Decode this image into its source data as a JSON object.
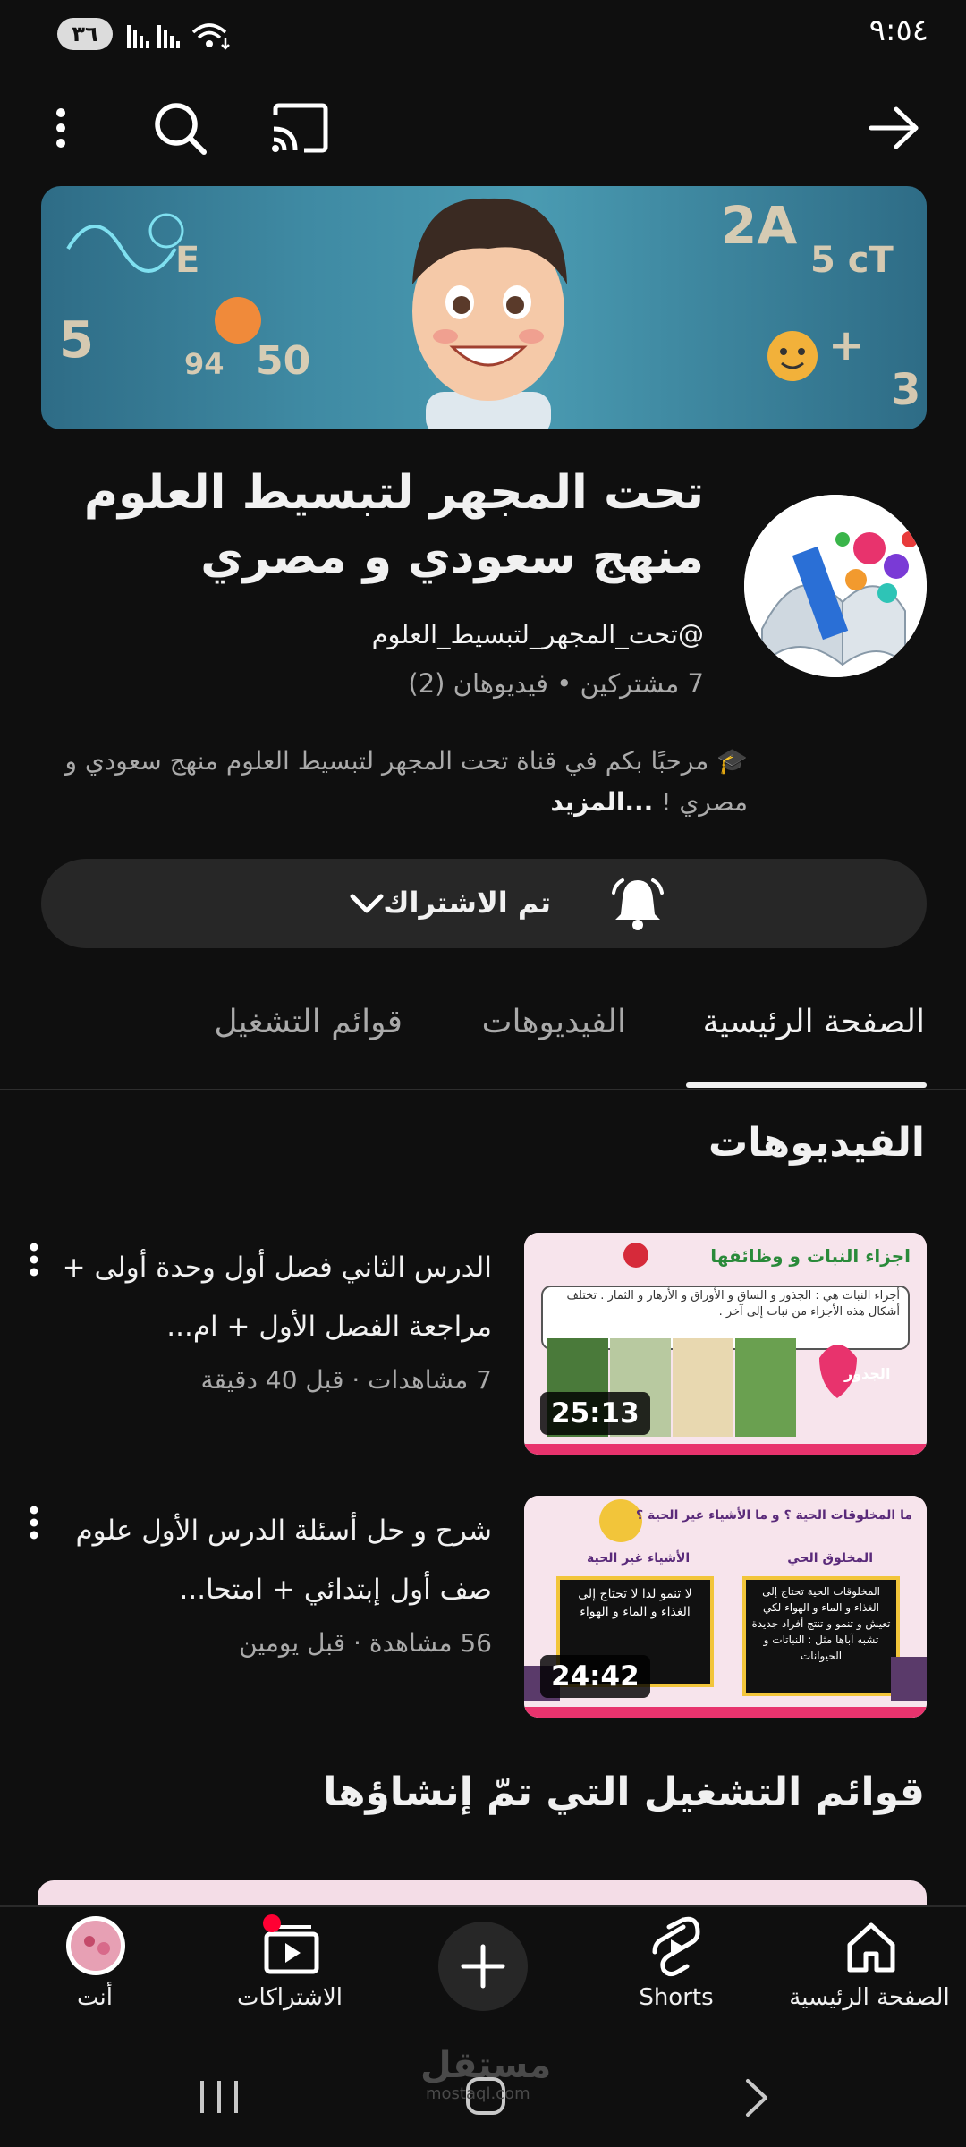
{
  "status_bar": {
    "time": "٩:٥٤",
    "battery": "٣٦"
  },
  "channel": {
    "title_line1": "تحت المجهر لتبسيط العلوم",
    "title_line2": "منهج سعودي و مصري",
    "handle": "@تحت_المجهر_لتبسيط_العلوم",
    "stats": "7 مشتركين • فيديوهان (2)",
    "description": "🎓 مرحبًا بكم في قناة  تحت المجهر لتبسيط العلوم منهج سعودي و مصري  ! ",
    "more_label": "...المزيد"
  },
  "subscribe": {
    "label": "تم الاشتراك"
  },
  "tabs": [
    {
      "label": "الصفحة الرئيسية",
      "active": true
    },
    {
      "label": "الفيديوهات",
      "active": false
    },
    {
      "label": "قوائم التشغيل",
      "active": false
    }
  ],
  "sections": {
    "videos_heading": "الفيديوهات",
    "playlists_heading": "قوائم التشغيل التي تمّ إنشاؤها"
  },
  "videos": [
    {
      "title": "الدرس الثاني فصل أول وحدة أولى + مراجعة الفصل الأول + ام...",
      "meta": "7 مشاهدات · قبل 40 دقيقة",
      "duration": "25:13",
      "thumb_heading": "اجزاء النبات و وظائفها",
      "thumb_text": "أجزاء النبات هي : الجذور و الساق و الأوراق و الأزهار و الثمار . تختلف أشكال هذه الأجزاء من نبات إلى آخر .",
      "thumb_badge": "الجذور"
    },
    {
      "title": "شرح و حل أسئلة الدرس الأول علوم صف أول إبتدائي + امتحا...",
      "meta": "56 مشاهدة · قبل يومين",
      "duration": "24:42",
      "thumb_heading": "ما المخلوقات الحية ؟ و ما الأشياء غير الحية ؟",
      "thumb_left_label": "الأشياء غير الحية",
      "thumb_right_label": "المخلوق الحي",
      "thumb_left_box": "لا تنمو  لذا لا تحتاج إلى الغذاء و الماء و الهواء",
      "thumb_right_box": "المخلوقات الحية تحتاج إلى الغذاء و الماء و الهواء لكي تعيش و تنمو و تنتج أفراد جديدة تشبه آباها مثل : النباتات و الحيوانات"
    }
  ],
  "bottom_nav": [
    {
      "label": "الصفحة الرئيسية",
      "icon": "home-icon"
    },
    {
      "label": "Shorts",
      "icon": "shorts-icon"
    },
    {
      "label": "",
      "icon": "plus-icon"
    },
    {
      "label": "الاشتراكات",
      "icon": "subscriptions-icon"
    },
    {
      "label": "أنت",
      "icon": "avatar"
    }
  ],
  "watermark": {
    "main": "مستقل",
    "sub": "mostaql.com"
  }
}
